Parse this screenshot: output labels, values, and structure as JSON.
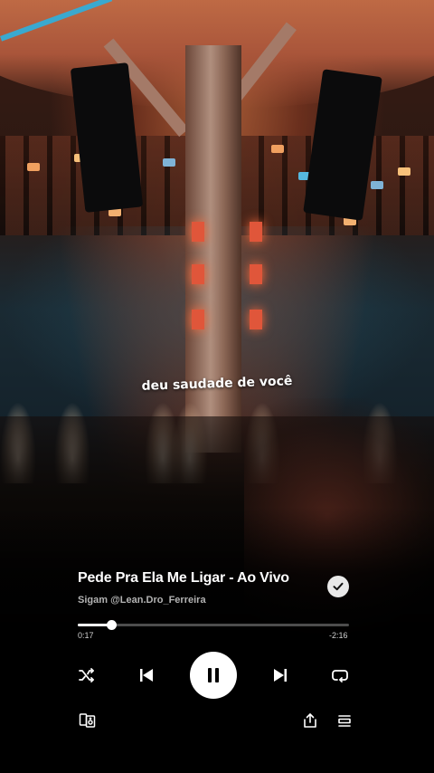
{
  "caption": "deu saudade de você",
  "player": {
    "title": "Pede Pra Ela Me Ligar - Ao Vivo",
    "artist": "Sigam @Lean.Dro_Ferreira",
    "liked": true,
    "is_playing": true,
    "elapsed": "0:17",
    "remaining": "-2:16",
    "progress_fraction": 0.123
  },
  "controls": {
    "shuffle": "shuffle-icon",
    "previous": "skip-previous-icon",
    "play_pause": "pause-icon",
    "next": "skip-next-icon",
    "repeat": "repeat-icon",
    "devices": "connect-device-icon",
    "share": "share-icon",
    "queue": "queue-icon"
  },
  "colors": {
    "accent": "#ffffff",
    "progress_track": "#4d4d4d",
    "secondary_text": "#b3b3b3"
  }
}
